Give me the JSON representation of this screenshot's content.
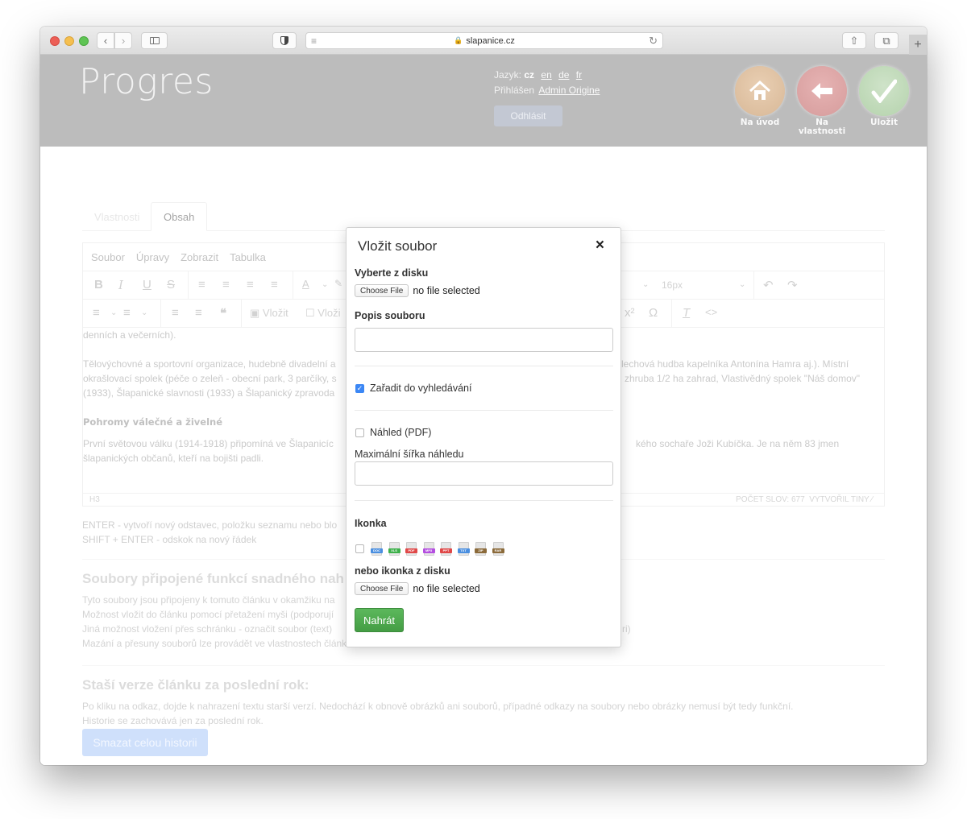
{
  "browser": {
    "url": "slapanice.cz",
    "new_tab_label": "+"
  },
  "header": {
    "logo": "Progres",
    "language_label": "Jazyk:",
    "current_language": "cz",
    "languages": [
      "en",
      "de",
      "fr"
    ],
    "logged_in_label": "Přihlášen",
    "user_name": "Admin Origine",
    "logout_label": "Odhlásit",
    "actions": [
      {
        "label": "Na úvod",
        "icon": "home-icon",
        "color": "#e0c4a5"
      },
      {
        "label": "Na vlastnosti",
        "icon": "arrow-left-icon",
        "color": "#dea8a8"
      },
      {
        "label": "Uložit",
        "icon": "checkmark-icon",
        "color": "#c3dbbc"
      }
    ]
  },
  "tabs": [
    {
      "label": "Vlastnosti",
      "active": false
    },
    {
      "label": "Obsah",
      "active": true
    }
  ],
  "editor": {
    "menu": [
      "Soubor",
      "Úpravy",
      "Zobrazit",
      "Tabulka"
    ],
    "font_size": "16px",
    "insert_image_label": "Vložit",
    "insert_file_label": "Vloži",
    "content": {
      "p0": "denních a večerních).",
      "p1_left": "Tělovýchovné a sportovní organizace, hudebně divadelní a",
      "p1_right": "lechová hudba kapelníka Antonína Hamra aj.). Místní",
      "p1_left_2": "okrašlovací spolek (péče o zeleň - obecní park, 3 parčíky, s",
      "p1_right_2": "zhruba 1/2 ha zahrad, Vlastivědný spolek \"Náš domov\"",
      "p1_left_3": "(1933), Šlapanické slavnosti (1933) a Šlapanický zpravoda",
      "heading": "Pohromy válečné a živelné",
      "p2_left": "První světovou válku (1914-1918) připomíná ve Šlapanicíc",
      "p2_right": "kého sochaře Joži Kubíčka. Je na něm 83 jmen",
      "p2_left_2": "šlapanických občanů, kteří na bojišti padli."
    },
    "status_path": "H3",
    "word_count": "POČET SLOV: 677",
    "powered_by": "VYTVOŘIL TINY"
  },
  "hints": {
    "line1": "ENTER - vytvoří nový odstavec, položku seznamu nebo blo",
    "line2": "SHIFT + ENTER - odskok na nový řádek"
  },
  "files_section": {
    "title": "Soubory připojené funkcí snadného nah",
    "lines": [
      "Tyto soubory jsou připojeny k tomuto článku v okamžiku na",
      "Možnost vložit do článku pomocí přetažení myši (podporují",
      "Jiná možnost vložení přes schránku - označit soubor (text)",
      "Mazání a přesuny souborů lze provádět ve vlastnostech článku."
    ],
    "line3_tail": "ri)"
  },
  "history_section": {
    "title": "Staší verze článku za poslední rok:",
    "lines": [
      "Po kliku na odkaz, dojde k nahrazení textu starší verzí. Nedochází k obnově obrázků ani souborů, případné odkazy na soubory nebo obrázky nemusí být tedy funkční.",
      "Historie se zachovává jen za poslední rok."
    ],
    "delete_button": "Smazat celou historii"
  },
  "modal": {
    "title": "Vložit soubor",
    "close": "×",
    "choose_from_disk_label": "Vyberte z disku",
    "choose_file_button": "Choose File",
    "no_file": "no file selected",
    "description_label": "Popis souboru",
    "description_value": "",
    "search_checkbox_label": "Zařadit do vyhledávání",
    "search_checked": true,
    "preview_checkbox_label": "Náhled (PDF)",
    "preview_checked": false,
    "max_width_label": "Maximální šířka náhledu",
    "max_width_value": "",
    "icon_label": "Ikonka",
    "icon_checked": false,
    "file_icons": [
      {
        "type": "DOC",
        "color": "#4a8fe0"
      },
      {
        "type": "XLS",
        "color": "#3db04a"
      },
      {
        "type": "PDF",
        "color": "#e04848"
      },
      {
        "type": "MP3",
        "color": "#b44fe0"
      },
      {
        "type": "PPT",
        "color": "#e04848"
      },
      {
        "type": "TXT",
        "color": "#4a8fe0"
      },
      {
        "type": "ZIP",
        "color": "#8b6a3a"
      },
      {
        "type": "RAR",
        "color": "#8b6a3a"
      }
    ],
    "icon_from_disk_label": "nebo ikonka z disku",
    "choose_icon_button": "Choose File",
    "no_icon_file": "no file selected",
    "upload_button": "Nahrát"
  }
}
